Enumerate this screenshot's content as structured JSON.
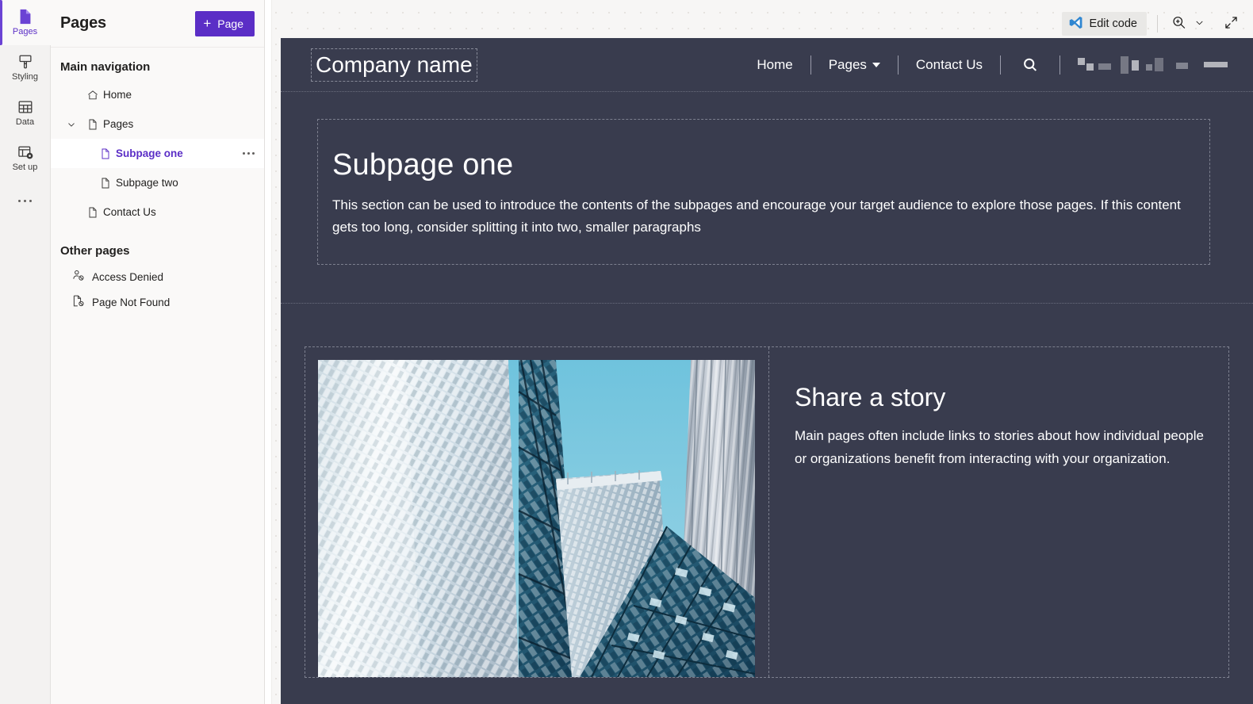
{
  "rail": {
    "items": [
      {
        "label": "Pages",
        "icon": "page-icon",
        "active": true
      },
      {
        "label": "Styling",
        "icon": "paintbrush-icon",
        "active": false
      },
      {
        "label": "Data",
        "icon": "table-icon",
        "active": false
      },
      {
        "label": "Set up",
        "icon": "setup-gear-icon",
        "active": false
      }
    ],
    "more_label": "..."
  },
  "panel": {
    "title": "Pages",
    "add_button": {
      "plus": "+",
      "label": "Page"
    },
    "groups": [
      {
        "title": "Main navigation",
        "items": [
          {
            "label": "Home",
            "icon": "home-icon",
            "indent": 1,
            "selected": false,
            "chevron": ""
          },
          {
            "label": "Pages",
            "icon": "document-icon",
            "indent": 1,
            "selected": false,
            "chevron": "expanded"
          },
          {
            "label": "Subpage one",
            "icon": "document-icon",
            "indent": 2,
            "selected": true,
            "chevron": ""
          },
          {
            "label": "Subpage two",
            "icon": "document-icon",
            "indent": 2,
            "selected": false,
            "chevron": ""
          },
          {
            "label": "Contact Us",
            "icon": "document-icon",
            "indent": 1,
            "selected": false,
            "chevron": ""
          }
        ]
      },
      {
        "title": "Other pages",
        "items": [
          {
            "label": "Access Denied",
            "icon": "person-blocked-icon"
          },
          {
            "label": "Page Not Found",
            "icon": "page-blocked-icon"
          }
        ]
      }
    ]
  },
  "toolbar": {
    "edit_code_label": "Edit code",
    "edit_code_icon": "vscode-icon",
    "zoom_icon": "zoom-in-icon",
    "zoom_chevron_icon": "chevron-down-icon",
    "expand_icon": "expand-diagonal-icon",
    "cursor_icon": "pointer-hand-cursor"
  },
  "site": {
    "brand": "Company name",
    "nav": [
      {
        "label": "Home",
        "dropdown": false
      },
      {
        "label": "Pages",
        "dropdown": true
      },
      {
        "label": "Contact Us",
        "dropdown": false
      }
    ],
    "search_icon": "search-icon",
    "redacted_label": "",
    "hero": {
      "title": "Subpage one",
      "body": "This section can be used to introduce the contents of the subpages and encourage your target audience to explore those pages. If this content gets too long, consider splitting it into two, smaller paragraphs"
    },
    "story": {
      "image_alt": "glass-skyscrapers-photo",
      "title": "Share a story",
      "body": "Main pages often include links to stories about how individual people or organizations benefit from interacting with your organization."
    }
  },
  "colors": {
    "accent_purple": "#5b2ec6",
    "site_bg": "#393c4e",
    "panel_bg": "#faf9f8",
    "canvas_bg": "#f7f6f5",
    "vscode_blue": "#2f86d1"
  }
}
